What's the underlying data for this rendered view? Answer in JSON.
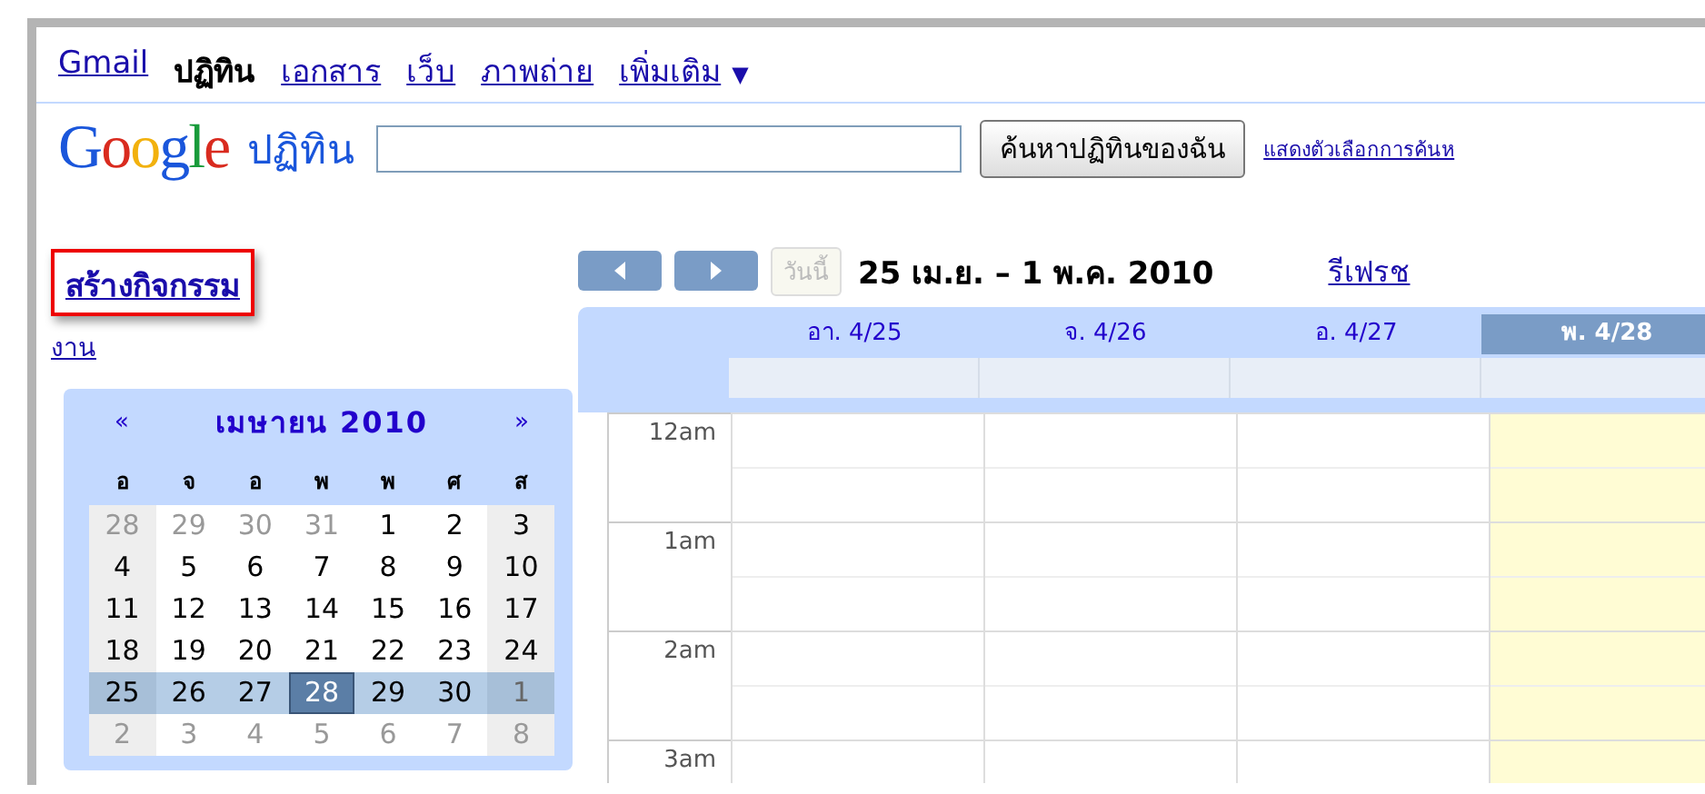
{
  "top_nav": [
    {
      "label": "Gmail",
      "selected": false
    },
    {
      "label": "ปฏิทิน",
      "selected": true
    },
    {
      "label": "เอกสาร",
      "selected": false
    },
    {
      "label": "เว็บ",
      "selected": false
    },
    {
      "label": "ภาพถ่าย",
      "selected": false
    },
    {
      "label": "เพิ่มเติม",
      "selected": false,
      "caret": "▼"
    }
  ],
  "logo": "Google",
  "product": "ปฏิทิน",
  "search": {
    "button": "ค้นหาปฏิทินของฉัน",
    "options_link": "แสดงตัวเลือกการค้นห"
  },
  "sidebar": {
    "create_event": "สร้างกิจกรรม",
    "tasks": "งาน",
    "mini_calendar": {
      "prev": "«",
      "title": "เมษายน 2010",
      "next": "»",
      "weekdays": [
        "อ",
        "จ",
        "อ",
        "พ",
        "พ",
        "ศ",
        "ส"
      ],
      "weeks": [
        {
          "selected": false,
          "days": [
            {
              "label": "28",
              "muted": true,
              "today": false
            },
            {
              "label": "29",
              "muted": true,
              "today": false
            },
            {
              "label": "30",
              "muted": true,
              "today": false
            },
            {
              "label": "31",
              "muted": true,
              "today": false
            },
            {
              "label": "1",
              "muted": false,
              "today": false
            },
            {
              "label": "2",
              "muted": false,
              "today": false
            },
            {
              "label": "3",
              "muted": false,
              "today": false
            }
          ]
        },
        {
          "selected": false,
          "days": [
            {
              "label": "4",
              "muted": false,
              "today": false
            },
            {
              "label": "5",
              "muted": false,
              "today": false
            },
            {
              "label": "6",
              "muted": false,
              "today": false
            },
            {
              "label": "7",
              "muted": false,
              "today": false
            },
            {
              "label": "8",
              "muted": false,
              "today": false
            },
            {
              "label": "9",
              "muted": false,
              "today": false
            },
            {
              "label": "10",
              "muted": false,
              "today": false
            }
          ]
        },
        {
          "selected": false,
          "days": [
            {
              "label": "11",
              "muted": false,
              "today": false
            },
            {
              "label": "12",
              "muted": false,
              "today": false
            },
            {
              "label": "13",
              "muted": false,
              "today": false
            },
            {
              "label": "14",
              "muted": false,
              "today": false
            },
            {
              "label": "15",
              "muted": false,
              "today": false
            },
            {
              "label": "16",
              "muted": false,
              "today": false
            },
            {
              "label": "17",
              "muted": false,
              "today": false
            }
          ]
        },
        {
          "selected": false,
          "days": [
            {
              "label": "18",
              "muted": false,
              "today": false
            },
            {
              "label": "19",
              "muted": false,
              "today": false
            },
            {
              "label": "20",
              "muted": false,
              "today": false
            },
            {
              "label": "21",
              "muted": false,
              "today": false
            },
            {
              "label": "22",
              "muted": false,
              "today": false
            },
            {
              "label": "23",
              "muted": false,
              "today": false
            },
            {
              "label": "24",
              "muted": false,
              "today": false
            }
          ]
        },
        {
          "selected": true,
          "days": [
            {
              "label": "25",
              "muted": false,
              "today": false
            },
            {
              "label": "26",
              "muted": false,
              "today": false
            },
            {
              "label": "27",
              "muted": false,
              "today": false
            },
            {
              "label": "28",
              "muted": false,
              "today": true
            },
            {
              "label": "29",
              "muted": false,
              "today": false
            },
            {
              "label": "30",
              "muted": false,
              "today": false
            },
            {
              "label": "1",
              "muted": true,
              "today": false
            }
          ]
        },
        {
          "selected": false,
          "days": [
            {
              "label": "2",
              "muted": true,
              "today": false
            },
            {
              "label": "3",
              "muted": true,
              "today": false
            },
            {
              "label": "4",
              "muted": true,
              "today": false
            },
            {
              "label": "5",
              "muted": true,
              "today": false
            },
            {
              "label": "6",
              "muted": true,
              "today": false
            },
            {
              "label": "7",
              "muted": true,
              "today": false
            },
            {
              "label": "8",
              "muted": true,
              "today": false
            }
          ]
        }
      ]
    }
  },
  "toolbar": {
    "today": "วันนี้",
    "today_disabled": true,
    "range": "25 เม.ย. – 1 พ.ค. 2010",
    "refresh": "รีเฟรช"
  },
  "day_headers": [
    {
      "label": "อา. 4/25",
      "selected": false
    },
    {
      "label": "จ. 4/26",
      "selected": false
    },
    {
      "label": "อ. 4/27",
      "selected": false
    },
    {
      "label": "พ. 4/28",
      "selected": true
    }
  ],
  "hours": [
    "12am",
    "1am",
    "2am",
    "3am"
  ]
}
